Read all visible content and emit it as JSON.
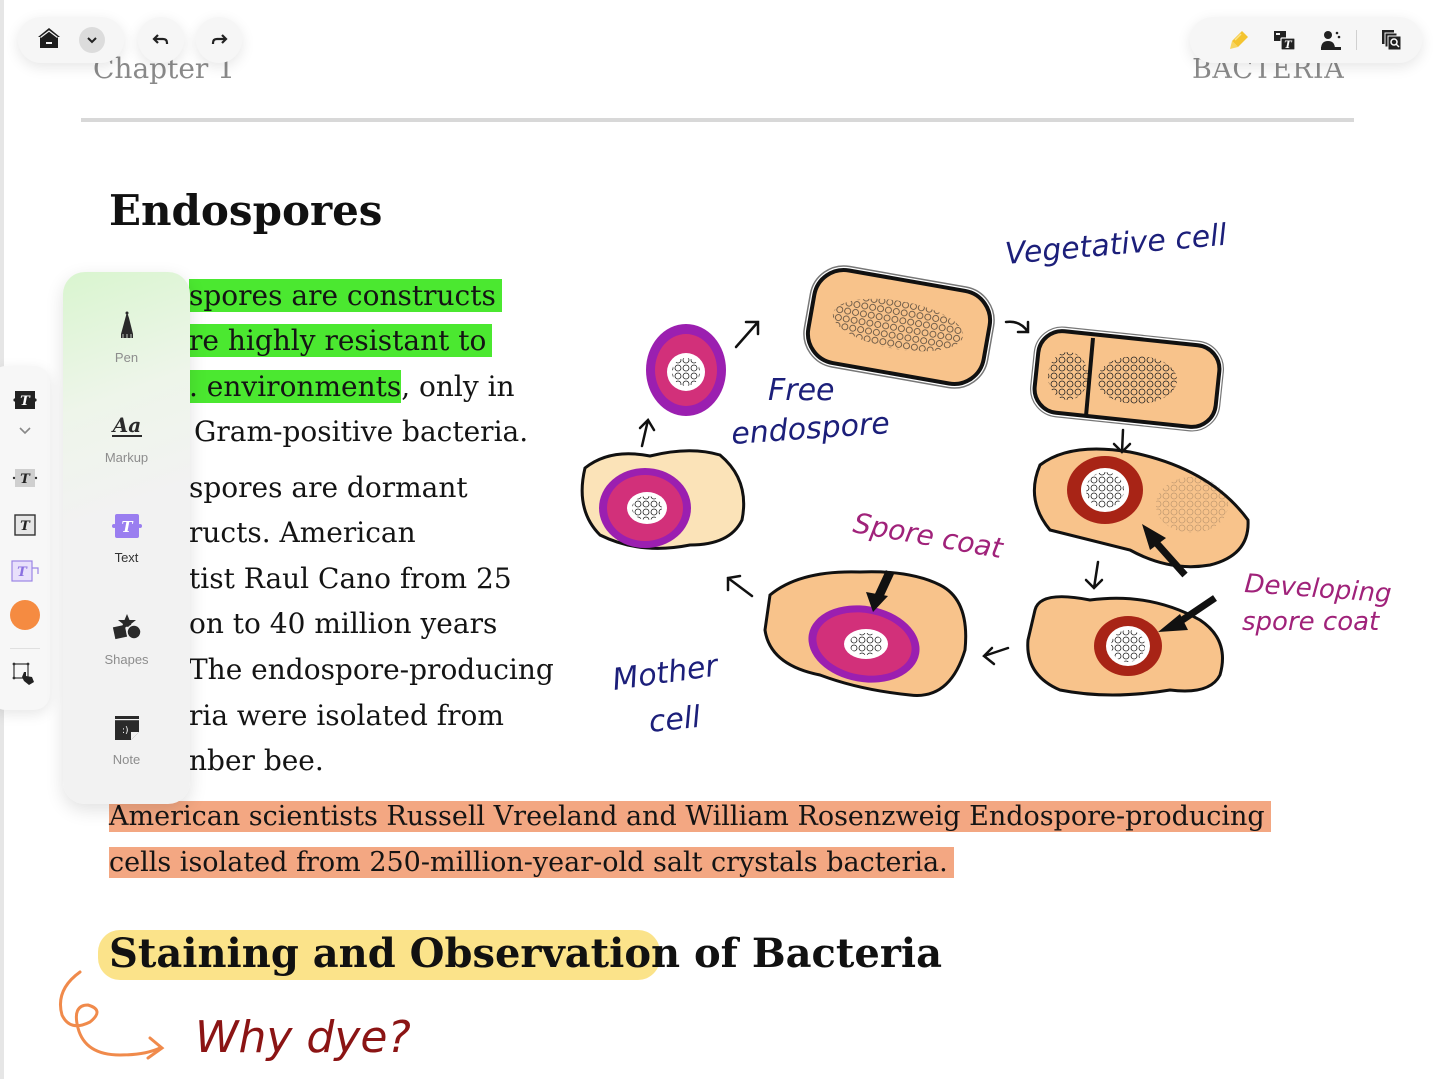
{
  "header": {
    "chapter": "Chapter 1",
    "book_title": "BACTERIA"
  },
  "toolbar_left": {
    "home_icon": "home-icon",
    "dropdown_icon": "chevron-down-icon",
    "undo_icon": "undo-icon",
    "redo_icon": "redo-icon"
  },
  "toolbar_right": {
    "items": [
      {
        "icon": "highlighter-pen-icon",
        "color": "#f4c430"
      },
      {
        "icon": "translate-icon"
      },
      {
        "icon": "read-aloud-icon"
      },
      {
        "icon": "page-search-icon"
      }
    ]
  },
  "text_style_panel": {
    "items": [
      {
        "icon": "text-filled-style-icon"
      },
      {
        "icon": "chevron-down-icon"
      },
      {
        "icon": "text-shaded-style-icon"
      },
      {
        "icon": "text-boxed-style-icon"
      },
      {
        "icon": "text-callout-style-icon"
      },
      {
        "icon": "color-swatch",
        "color": "#f58b41"
      },
      {
        "icon": "lasso-select-icon"
      }
    ]
  },
  "tool_panel": {
    "tools": [
      {
        "label": "Pen",
        "icon": "pen-icon",
        "active": false
      },
      {
        "label": "Markup",
        "icon": "markup-icon",
        "active": false
      },
      {
        "label": "Text",
        "icon": "text-tool-icon",
        "active": true
      },
      {
        "label": "Shapes",
        "icon": "shapes-icon",
        "active": false
      },
      {
        "label": "Note",
        "icon": "note-icon",
        "active": false
      }
    ]
  },
  "content": {
    "heading1": "Endospores",
    "paragraph1": [
      {
        "highlighted": "spores are constructs",
        "rest": ""
      },
      {
        "highlighted": "re highly resistant to",
        "rest": ""
      },
      {
        "highlighted": ". environments",
        "rest": ", only in"
      },
      {
        "highlighted": "",
        "rest": "Gram-positive bacteria."
      }
    ],
    "paragraph2": [
      "spores are dormant",
      "ructs. American",
      "tist Raul Cano from 25",
      "on to 40 million years",
      "The endospore-producing",
      "ria were isolated from",
      "nber bee."
    ],
    "paragraph3": [
      "American scientists Russell Vreeland and William Rosenzweig Endospore-producing",
      "cells isolated from 250-million-year-old salt crystals bacteria."
    ],
    "heading2_highlighted": "Staining and Observation",
    "heading2_rest": " of Bacteria",
    "handwritten_note": "Why dye?",
    "highlight_colors": {
      "green": "#4be830",
      "orange": "#f3a782",
      "yellow": "#fbe38a"
    }
  },
  "diagram": {
    "labels": {
      "vegetative": "Vegetative cell",
      "free_endospore_1": "Free",
      "free_endospore_2": "endospore",
      "spore_coat": "Spore coat",
      "developing_1": "Developing",
      "developing_2": "spore coat",
      "mother_1": "Mother",
      "mother_2": "cell"
    },
    "colors": {
      "label_blue": "#1c1f7a",
      "label_magenta": "#a0227a",
      "cell_fill": "#f8c38b",
      "cell_pale": "#fbe3b8",
      "coat_purple": "#9b1fb0",
      "coat_pink": "#d2307a",
      "coat_red": "#a82416"
    }
  }
}
